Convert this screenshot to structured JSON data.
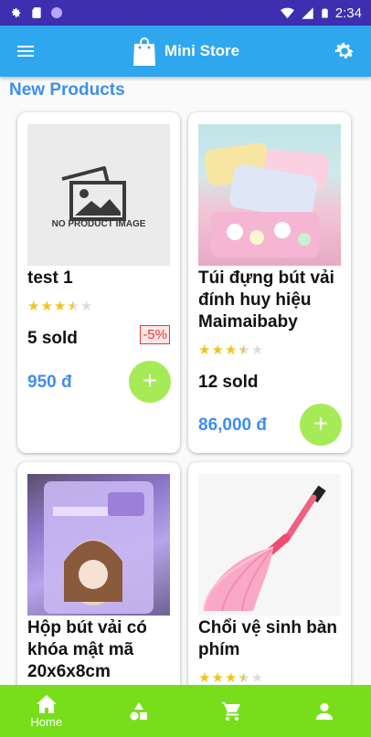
{
  "status_bar": {
    "time": "2:34",
    "left_icons": [
      "settings-icon",
      "sd-card-icon",
      "notification-dot-icon"
    ],
    "right_icons": [
      "wifi-icon",
      "signal-icon",
      "battery-icon"
    ]
  },
  "app_bar": {
    "title": "Mini Store",
    "menu_icon": "menu-icon",
    "logo_icon": "shopping-bag-icon",
    "settings_icon": "gear-icon"
  },
  "section": {
    "title": "New Products"
  },
  "colors": {
    "status_bar": "#3d2fb0",
    "app_bar": "#2fa7ee",
    "accent_blue": "#3f8ef0",
    "add_button": "#a6ea55",
    "bottom_nav": "#78de1b",
    "discount_red": "#e53935"
  },
  "products": [
    {
      "name": "test 1",
      "rating": 3.5,
      "sold": "5 sold",
      "discount": "-5%",
      "price": "950 đ",
      "image": "placeholder",
      "placeholder_text": "NO PRODUCT IMAGE"
    },
    {
      "name": "Túi đựng bút vải đính huy hiệu Maimaibaby",
      "rating": 3.5,
      "sold": "12 sold",
      "price": "86,000 đ",
      "image": "pencil-case-photo"
    },
    {
      "name": "Hộp bút vải có khóa mật mã 20x6x8cm",
      "rating": 3.5,
      "image": "pencil-box-photo"
    },
    {
      "name": "Chổi vệ sinh bàn phím",
      "rating": 3.5,
      "image": "keyboard-brush-photo"
    }
  ],
  "bottom_nav": {
    "items": [
      {
        "label": "Home",
        "icon": "home-icon",
        "active": true
      },
      {
        "label": "",
        "icon": "categories-icon"
      },
      {
        "label": "",
        "icon": "cart-icon"
      },
      {
        "label": "",
        "icon": "account-icon"
      }
    ]
  }
}
